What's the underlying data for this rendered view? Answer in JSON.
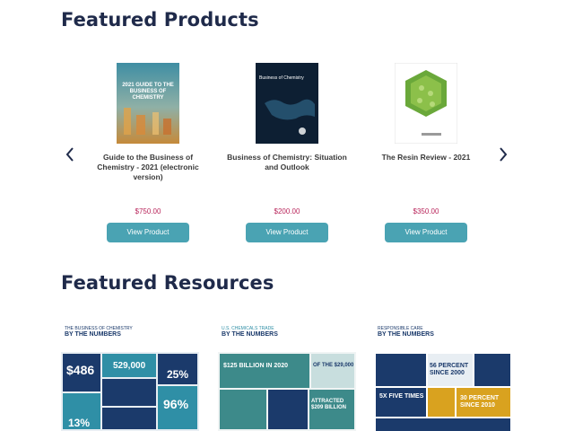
{
  "featured_products": {
    "title": "Featured Products",
    "items": [
      {
        "cover_title": "2021 GUIDE TO THE BUSINESS OF CHEMISTRY",
        "name": "Guide to the Business of Chemistry - 2021 (electronic version)",
        "price": "$750.00",
        "button": "View Product"
      },
      {
        "cover_title": "Business of Chemistry",
        "name": "Business of Chemistry: Situation and Outlook",
        "price": "$200.00",
        "button": "View Product"
      },
      {
        "cover_title": "",
        "name": "The Resin Review - 2021",
        "price": "$350.00",
        "button": "View Product"
      }
    ]
  },
  "featured_resources": {
    "title": "Featured Resources",
    "items": [
      {
        "heading": "THE BUSINESS OF CHEMISTRY",
        "subheading": "BY THE NUMBERS",
        "stats": [
          "$486",
          "529,000",
          "25%",
          "96%",
          "13%"
        ]
      },
      {
        "heading": "U.S. CHEMICALS TRADE",
        "subheading": "BY THE NUMBERS",
        "stats": [
          "$125 BILLION IN 2020",
          "OF THE $29,000",
          "ATTRACTED $209 BILLION"
        ]
      },
      {
        "heading": "RESPONSIBLE CARE",
        "subheading": "BY THE NUMBERS",
        "stats": [
          "56 PERCENT SINCE 2000",
          "5X FIVE TIMES",
          "30 PERCENT SINCE 2010"
        ]
      }
    ]
  },
  "colors": {
    "accent": "#4aa3b3",
    "price": "#b8245a",
    "heading": "#1f2a4a",
    "navy": "#1b3a6b",
    "teal": "#2f8fa6",
    "gold": "#d9a21f"
  }
}
